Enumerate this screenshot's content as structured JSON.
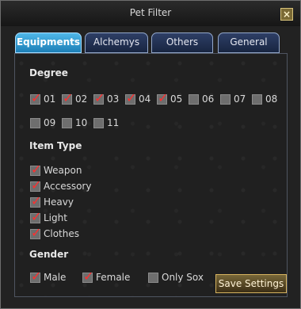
{
  "window": {
    "title": "Pet Filter",
    "close_icon": "close-icon"
  },
  "tabs": [
    {
      "label": "Equipments",
      "active": true
    },
    {
      "label": "Alchemys",
      "active": false
    },
    {
      "label": "Others",
      "active": false
    },
    {
      "label": "General",
      "active": false
    }
  ],
  "degree": {
    "title": "Degree",
    "items": [
      {
        "label": "01",
        "checked": true
      },
      {
        "label": "02",
        "checked": true
      },
      {
        "label": "03",
        "checked": true
      },
      {
        "label": "04",
        "checked": true
      },
      {
        "label": "05",
        "checked": true
      },
      {
        "label": "06",
        "checked": false
      },
      {
        "label": "07",
        "checked": false
      },
      {
        "label": "08",
        "checked": false
      },
      {
        "label": "09",
        "checked": false
      },
      {
        "label": "10",
        "checked": false
      },
      {
        "label": "11",
        "checked": false
      }
    ]
  },
  "item_type": {
    "title": "Item Type",
    "items": [
      {
        "label": "Weapon",
        "checked": true
      },
      {
        "label": "Accessory",
        "checked": true
      },
      {
        "label": "Heavy",
        "checked": true
      },
      {
        "label": "Light",
        "checked": true
      },
      {
        "label": "Clothes",
        "checked": true
      }
    ]
  },
  "gender": {
    "title": "Gender",
    "items": [
      {
        "label": "Male",
        "checked": true
      },
      {
        "label": "Female",
        "checked": true
      },
      {
        "label": "Only Sox",
        "checked": false
      }
    ]
  },
  "save_button": "Save Settings"
}
